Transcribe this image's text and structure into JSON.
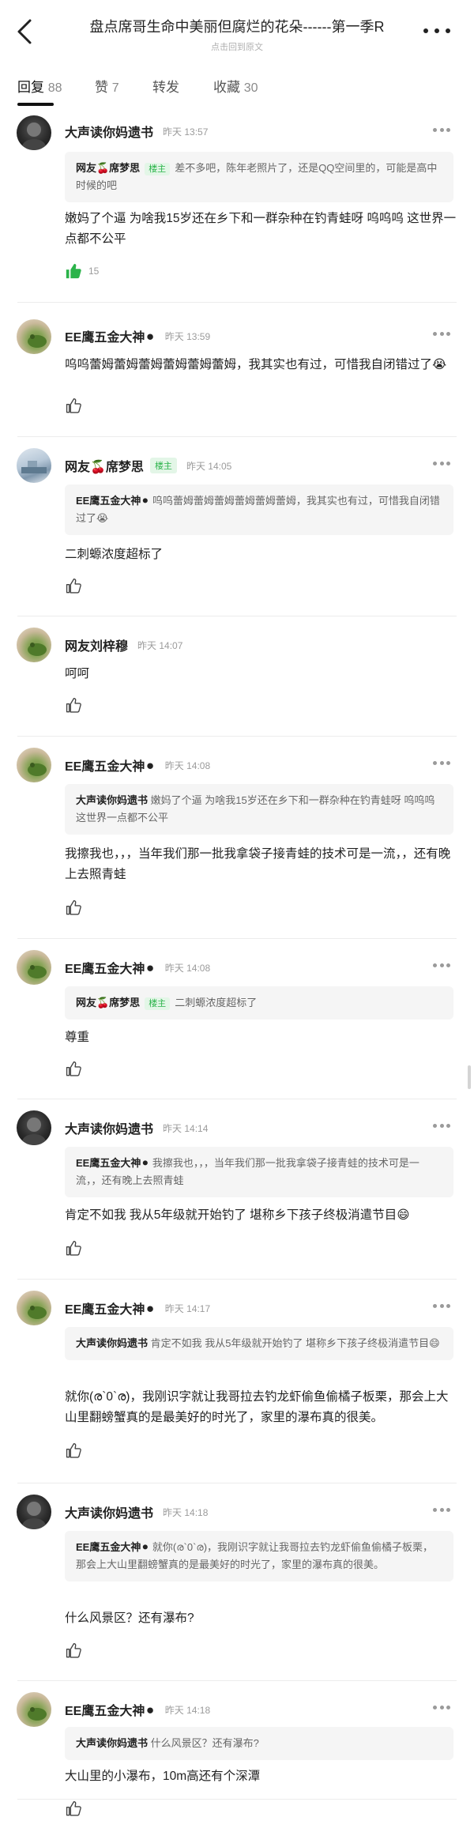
{
  "header": {
    "title": "盘点席哥生命中美丽但腐烂的花朵------第一季R",
    "subtitle": "点击回到原文"
  },
  "tabs": [
    {
      "label": "回复",
      "count": "88"
    },
    {
      "label": "赞",
      "count": "7"
    },
    {
      "label": "转发",
      "count": ""
    },
    {
      "label": "收藏",
      "count": "30"
    }
  ],
  "comments": [
    {
      "user": "大声读你妈遗书",
      "badge": "",
      "time": "昨天 13:57",
      "quote": {
        "user": "网友🍒席梦思",
        "badge": "楼主",
        "text": "差不多吧，陈年老照片了，还是QQ空间里的，可能是高中时候的吧"
      },
      "text": "嫩妈了个逼 为啥我15岁还在乡下和一群杂种在钓青蛙呀 呜呜呜 这世界一点都不公平",
      "likes": "15"
    },
    {
      "user": "EE鹰五金大神⚫",
      "badge": "",
      "time": "昨天 13:59",
      "quote": null,
      "text": "呜呜蕾姆蕾姆蕾姆蕾姆蕾姆蕾姆，我其实也有过，可惜我自闭错过了😭",
      "likes": ""
    },
    {
      "user": "网友🍒席梦思",
      "badge": "楼主",
      "time": "昨天 14:05",
      "quote": {
        "user": "EE鹰五金大神⚫",
        "badge": "",
        "text": "呜呜蕾姆蕾姆蕾姆蕾姆蕾姆蕾姆，我其实也有过，可惜我自闭错过了😭"
      },
      "text": "二刺螈浓度超标了",
      "likes": ""
    },
    {
      "user": "网友刘梓穆",
      "badge": "",
      "time": "昨天 14:07",
      "quote": null,
      "text": "呵呵",
      "likes": ""
    },
    {
      "user": "EE鹰五金大神⚫",
      "badge": "",
      "time": "昨天 14:08",
      "quote": {
        "user": "大声读你妈遗书",
        "badge": "",
        "text": "嫩妈了个逼 为啥我15岁还在乡下和一群杂种在钓青蛙呀 呜呜呜 这世界一点都不公平"
      },
      "text": "我擦我也，，，当年我们那一批我拿袋子接青蛙的技术可是一流，，还有晚上去照青蛙",
      "likes": ""
    },
    {
      "user": "EE鹰五金大神⚫",
      "badge": "",
      "time": "昨天 14:08",
      "quote": {
        "user": "网友🍒席梦思",
        "badge": "楼主",
        "text": "二刺螈浓度超标了"
      },
      "text": "尊重",
      "likes": ""
    },
    {
      "user": "大声读你妈遗书",
      "badge": "",
      "time": "昨天 14:14",
      "quote": {
        "user": "EE鹰五金大神⚫",
        "badge": "",
        "text": "我擦我也，，，当年我们那一批我拿袋子接青蛙的技术可是一流，，还有晚上去照青蛙"
      },
      "text": "肯定不如我 我从5年级就开始钓了 堪称乡下孩子终极消遣节目😄",
      "likes": ""
    },
    {
      "user": "EE鹰五金大神⚫",
      "badge": "",
      "time": "昨天 14:17",
      "quote": {
        "user": "大声读你妈遗书",
        "badge": "",
        "text": "肯定不如我 我从5年级就开始钓了 堪称乡下孩子终极消遣节目😄"
      },
      "text": "就你(ര`0`ര)，我刚识字就让我哥拉去钓龙虾偷鱼偷橘子板栗，那会上大山里翻螃蟹真的是最美好的时光了，家里的瀑布真的很美。",
      "likes": ""
    },
    {
      "user": "大声读你妈遗书",
      "badge": "",
      "time": "昨天 14:18",
      "quote": {
        "user": "EE鹰五金大神⚫",
        "badge": "",
        "text": "就你(ര`0`ര)，我刚识字就让我哥拉去钓龙虾偷鱼偷橘子板栗，那会上大山里翻螃蟹真的是最美好的时光了，家里的瀑布真的很美。"
      },
      "text": "什么风景区？还有瀑布?",
      "likes": ""
    },
    {
      "user": "EE鹰五金大神⚫",
      "badge": "",
      "time": "昨天 14:18",
      "quote": {
        "user": "大声读你妈遗书",
        "badge": "",
        "text": "什么风景区？还有瀑布?"
      },
      "text": "大山里的小瀑布，10m高还有个深潭",
      "likes": ""
    }
  ]
}
